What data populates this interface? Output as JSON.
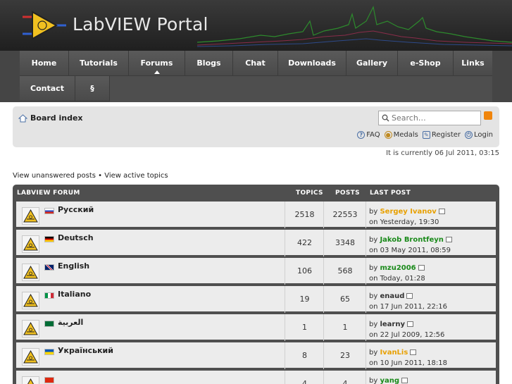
{
  "header": {
    "title": "LabVIEW Portal"
  },
  "nav": {
    "items": [
      {
        "label": "Home"
      },
      {
        "label": "Tutorials"
      },
      {
        "label": "Forums"
      },
      {
        "label": "Blogs"
      },
      {
        "label": "Chat"
      },
      {
        "label": "Downloads"
      },
      {
        "label": "Gallery"
      },
      {
        "label": "e-Shop"
      },
      {
        "label": "Links"
      },
      {
        "label": "Contact"
      },
      {
        "label": "§"
      }
    ],
    "active": "Forums"
  },
  "board": {
    "index_label": "Board index",
    "search_placeholder": "Search…",
    "toolbar": {
      "faq": "FAQ",
      "medals": "Medals",
      "register": "Register",
      "login": "Login"
    }
  },
  "status": {
    "currently": "It is currently 06 Jul 2011, 03:15"
  },
  "links": {
    "unanswered": "View unanswered posts",
    "separator": " • ",
    "active": "View active topics"
  },
  "forum": {
    "headers": {
      "name": "LABVIEW FORUM",
      "topics": "TOPICS",
      "posts": "POSTS",
      "last": "LAST POST"
    },
    "rows": [
      {
        "name": "Русский",
        "flag": "ru",
        "topics": "2518",
        "posts": "22553",
        "by": "by",
        "author": "Sergey Ivanov",
        "author_color": "#e8a000",
        "on": "on Yesterday, 19:30"
      },
      {
        "name": "Deutsch",
        "flag": "de",
        "topics": "422",
        "posts": "3348",
        "by": "by",
        "author": "Jakob Brontfeyn",
        "author_color": "#1a8a1a",
        "on": "on 03 May 2011, 08:59"
      },
      {
        "name": "English",
        "flag": "gb",
        "topics": "106",
        "posts": "568",
        "by": "by",
        "author": "mzu2006",
        "author_color": "#1a8a1a",
        "on": "on Today, 01:28"
      },
      {
        "name": "Italiano",
        "flag": "it",
        "topics": "19",
        "posts": "65",
        "by": "by",
        "author": "enaud",
        "author_color": "#333333",
        "on": "on 17 Jun 2011, 22:16"
      },
      {
        "name": "العربية",
        "flag": "sa",
        "topics": "1",
        "posts": "1",
        "by": "by",
        "author": "learny",
        "author_color": "#333333",
        "on": "on 22 Jul 2009, 12:56"
      },
      {
        "name": "Український",
        "flag": "ua",
        "topics": "8",
        "posts": "23",
        "by": "by",
        "author": "IvanLis",
        "author_color": "#e8a000",
        "on": "on 10 Jun 2011, 18:18"
      },
      {
        "name": "",
        "flag": "cn",
        "topics": "4",
        "posts": "4",
        "by": "by",
        "author": "yang",
        "author_color": "#1a8a1a",
        "on": ""
      }
    ]
  },
  "colors": {
    "nav_bg": "#4e4e4e",
    "accent_orange": "#e8a000",
    "accent_green": "#1a8a1a"
  }
}
